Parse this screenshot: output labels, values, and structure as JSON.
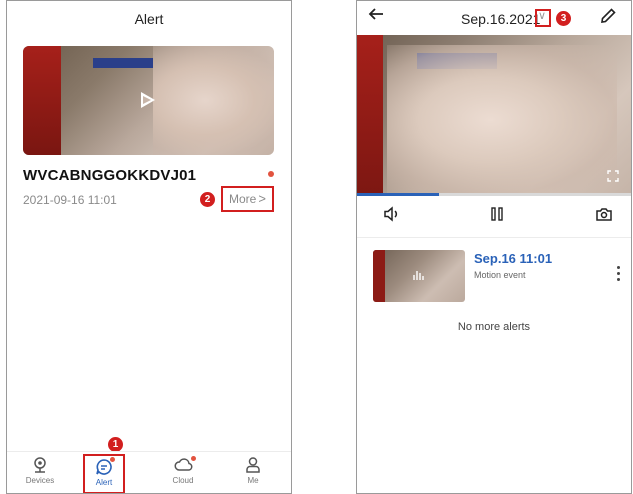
{
  "alert_screen": {
    "title": "Alert",
    "device_name": "WVCABNGGOKKDVJ01",
    "timestamp": "2021-09-16 11:01",
    "more_label": "More",
    "more_chevron": ">",
    "callout_more": "2",
    "callout_alert_tab": "1",
    "tabs": [
      {
        "label": "Devices",
        "icon": "camera-icon",
        "active": false,
        "has_dot": false
      },
      {
        "label": "Alert",
        "icon": "alert-chat-icon",
        "active": true,
        "has_dot": true
      },
      {
        "label": "Cloud",
        "icon": "cloud-icon",
        "active": false,
        "has_dot": true
      },
      {
        "label": "Me",
        "icon": "person-icon",
        "active": false,
        "has_dot": false
      }
    ]
  },
  "playback_screen": {
    "date": "Sep.16.2021",
    "dropdown_chevron": "∨",
    "callout_date": "3",
    "back_icon": "back-arrow-icon",
    "edit_icon": "pencil-icon",
    "progress": 0.3,
    "controls": [
      {
        "icon": "volume-icon"
      },
      {
        "icon": "pause-icon"
      },
      {
        "icon": "snapshot-camera-icon"
      }
    ],
    "events": [
      {
        "time": "Sep.16 11:01",
        "type": "Motion event"
      }
    ],
    "no_more": "No more alerts"
  },
  "colors": {
    "accent": "#2a62b8",
    "callout": "#d21f1f",
    "notification_dot": "#e2533f"
  }
}
